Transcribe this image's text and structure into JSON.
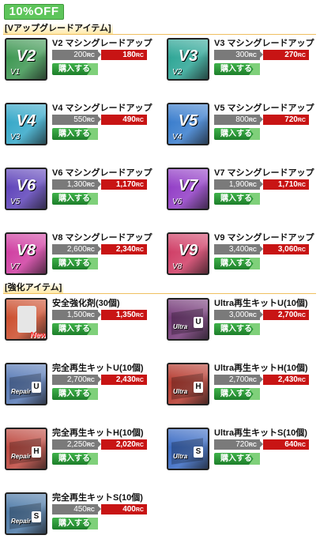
{
  "banner": "10%OFF",
  "sections": {
    "upgrade": "[Vアップグレードアイテム]",
    "enhance": "[強化アイテム]"
  },
  "currency": "RC",
  "buy_label": "購入する",
  "items": [
    {
      "name": "V2 マシングレードアップ",
      "price": "200",
      "sale": "180",
      "icon": "v-upgrade-icon",
      "big": "V2",
      "small": "V1",
      "color": "#2f8f45"
    },
    {
      "name": "V3 マシングレードアップ",
      "price": "300",
      "sale": "270",
      "icon": "v-upgrade-icon",
      "big": "V3",
      "small": "V2",
      "color": "#1e9f8e"
    },
    {
      "name": "V4 マシングレードアップ",
      "price": "550",
      "sale": "490",
      "icon": "v-upgrade-icon",
      "big": "V4",
      "small": "V3",
      "color": "#26a1c4"
    },
    {
      "name": "V5 マシングレードアップ",
      "price": "800",
      "sale": "720",
      "icon": "v-upgrade-icon",
      "big": "V5",
      "small": "V4",
      "color": "#2a73c9"
    },
    {
      "name": "V6 マシングレードアップ",
      "price": "1,300",
      "sale": "1,170",
      "icon": "v-upgrade-icon",
      "big": "V6",
      "small": "V5",
      "color": "#5336b5"
    },
    {
      "name": "V7 マシングレードアップ",
      "price": "1,900",
      "sale": "1,710",
      "icon": "v-upgrade-icon",
      "big": "V7",
      "small": "V6",
      "color": "#8a2fc2"
    },
    {
      "name": "V8 マシングレードアップ",
      "price": "2,600",
      "sale": "2,340",
      "icon": "v-upgrade-icon",
      "big": "V8",
      "small": "V7",
      "color": "#cc2f9a"
    },
    {
      "name": "V9 マシングレードアップ",
      "price": "3,400",
      "sale": "3,060",
      "icon": "v-upgrade-icon",
      "big": "V9",
      "small": "V8",
      "color": "#cc2f5a"
    },
    {
      "name": "安全強化剤(30個)",
      "price": "1,500",
      "sale": "1,350",
      "icon": "safety-enhancer-icon",
      "tag": "New",
      "color": "#c8411e"
    },
    {
      "name": "Ultra再生キットU(10個)",
      "price": "3,000",
      "sale": "2,700",
      "icon": "ultra-repair-kit-icon",
      "letter": "U",
      "kit": "Ultra",
      "color": "#6a2a6e"
    },
    {
      "name": "完全再生キットU(10個)",
      "price": "2,700",
      "sale": "2,430",
      "icon": "repair-kit-icon",
      "letter": "U",
      "kit": "Repair",
      "color": "#4a6fb0"
    },
    {
      "name": "Ultra再生キットH(10個)",
      "price": "2,700",
      "sale": "2,430",
      "icon": "ultra-repair-kit-icon",
      "letter": "H",
      "kit": "Ultra",
      "color": "#b02a1e"
    },
    {
      "name": "完全再生キットH(10個)",
      "price": "2,250",
      "sale": "2,020",
      "icon": "repair-kit-icon",
      "letter": "H",
      "kit": "Repair",
      "color": "#b83a30"
    },
    {
      "name": "Ultra再生キットS(10個)",
      "price": "720",
      "sale": "640",
      "icon": "ultra-repair-kit-icon",
      "letter": "S",
      "kit": "Ultra",
      "color": "#2a5fbf"
    },
    {
      "name": "完全再生キットS(10個)",
      "price": "450",
      "sale": "400",
      "icon": "repair-kit-icon",
      "letter": "S",
      "kit": "Repair",
      "color": "#3f6fa0"
    }
  ]
}
